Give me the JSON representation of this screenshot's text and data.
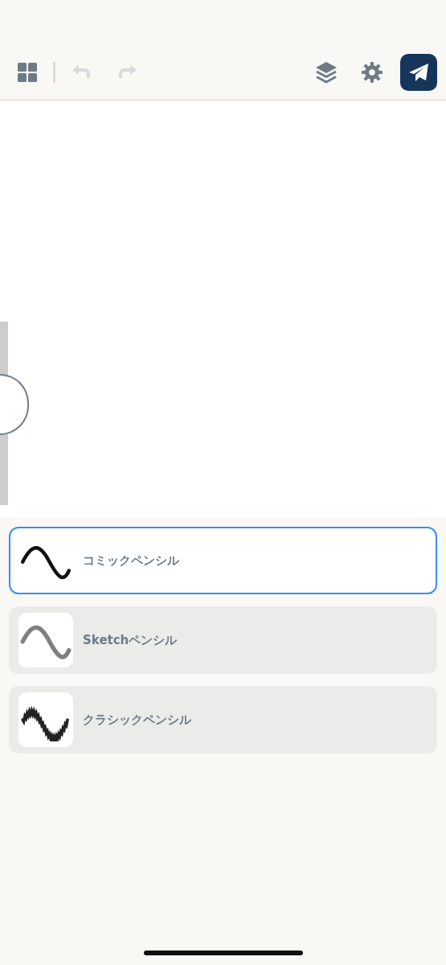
{
  "toolbar": {
    "undo": {
      "disabled": true
    },
    "redo": {
      "disabled": true
    }
  },
  "size_slider": {
    "level": 0.55
  },
  "brushes": [
    {
      "name": "コミックペンシル",
      "kind": "smooth",
      "selected": true
    },
    {
      "name": "Sketchペンシル",
      "kind": "sketch",
      "selected": false
    },
    {
      "name": "クラシックペンシル",
      "kind": "rough",
      "selected": false
    }
  ]
}
